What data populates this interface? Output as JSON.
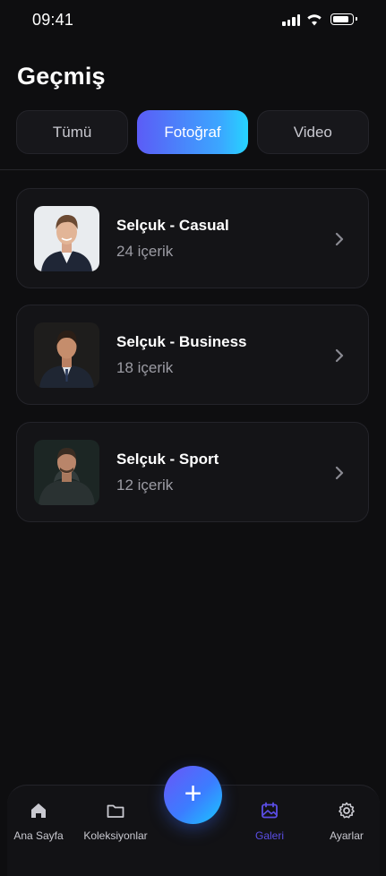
{
  "status": {
    "time": "09:41"
  },
  "page": {
    "title": "Geçmiş"
  },
  "tabs": [
    {
      "label": "Tümü",
      "active": false
    },
    {
      "label": "Fotoğraf",
      "active": true
    },
    {
      "label": "Video",
      "active": false
    }
  ],
  "collections": [
    {
      "name": "Selçuk - Casual",
      "count": "24 içerik"
    },
    {
      "name": "Selçuk - Business",
      "count": "18 içerik"
    },
    {
      "name": "Selçuk - Sport",
      "count": "12 içerik"
    }
  ],
  "nav": {
    "items": [
      {
        "label": "Ana Sayfa",
        "icon": "home-icon"
      },
      {
        "label": "Koleksiyonlar",
        "icon": "folder-icon"
      },
      {
        "label": "Galeri",
        "icon": "gallery-icon",
        "active": true
      },
      {
        "label": "Ayarlar",
        "icon": "gear-icon"
      }
    ],
    "fab_symbol": "+"
  },
  "colors": {
    "accent": "#5b5cf6",
    "accent_end": "#26d4ff",
    "active_nav": "#5b4ee6",
    "background": "#0e0e10"
  }
}
